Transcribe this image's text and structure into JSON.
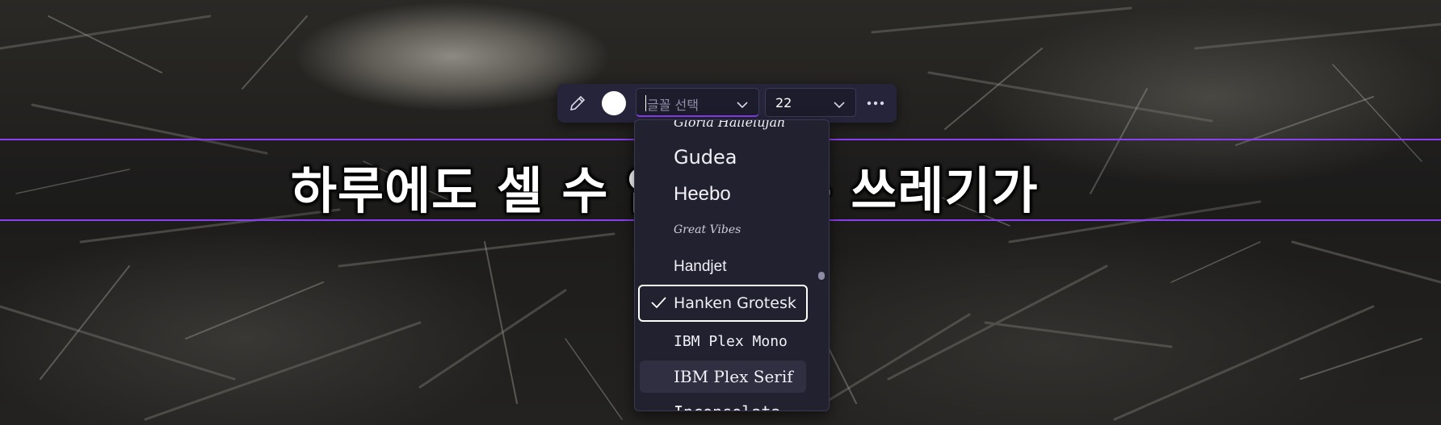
{
  "caption": {
    "text": "하루에도 셀 수 없이 많은 쓰레기가"
  },
  "toolbar": {
    "pencil_icon": "pencil-icon",
    "color_value": "#ffffff",
    "font_select": {
      "placeholder": "글꼴 선택"
    },
    "font_size": {
      "value": "22"
    },
    "more_icon": "more-horizontal-icon"
  },
  "font_dropdown": {
    "options": [
      {
        "label": "Gloria Hallelujah"
      },
      {
        "label": "Gudea"
      },
      {
        "label": "Heebo"
      },
      {
        "label": "Great Vibes"
      },
      {
        "label": "Handjet"
      },
      {
        "label": "Hanken Grotesk",
        "selected": true
      },
      {
        "label": "IBM Plex Mono"
      },
      {
        "label": "IBM Plex Serif",
        "hovered": true
      },
      {
        "label": "Inconsolata"
      }
    ]
  },
  "colors": {
    "accent": "#8a3ff3",
    "panel": "#25243a",
    "dropdown": "#22212f"
  }
}
